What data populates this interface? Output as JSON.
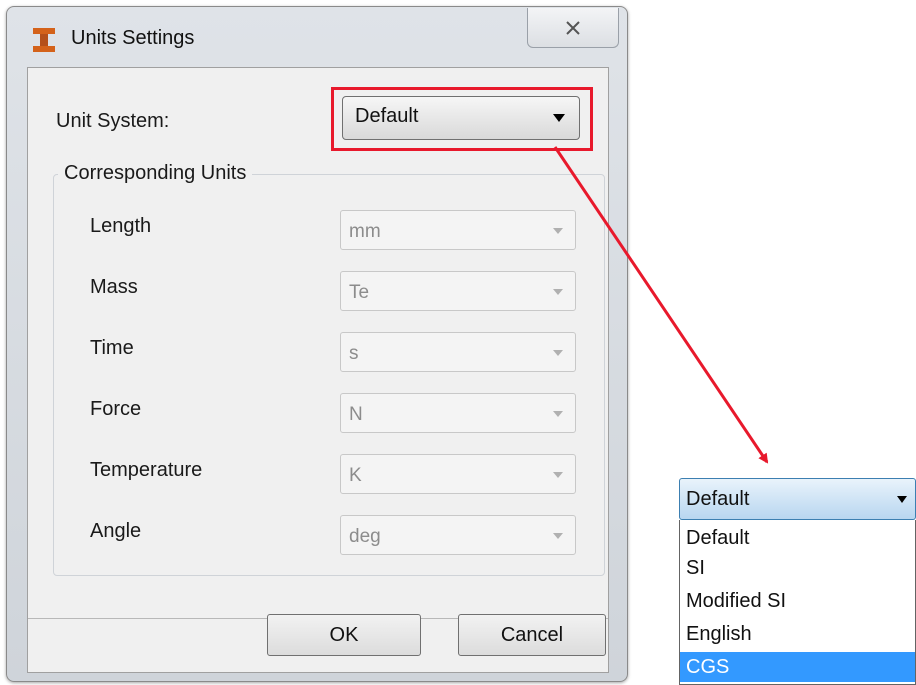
{
  "window": {
    "title": "Units Settings",
    "close_glyph": "✕"
  },
  "unit_system": {
    "label": "Unit System:",
    "value": "Default"
  },
  "group": {
    "title": "Corresponding Units",
    "rows": [
      {
        "label": "Length",
        "value": "mm"
      },
      {
        "label": "Mass",
        "value": "Te"
      },
      {
        "label": "Time",
        "value": "s"
      },
      {
        "label": "Force",
        "value": "N"
      },
      {
        "label": "Temperature",
        "value": "K"
      },
      {
        "label": "Angle",
        "value": "deg"
      }
    ]
  },
  "buttons": {
    "ok": "OK",
    "cancel": "Cancel"
  },
  "dropdown": {
    "value": "Default",
    "options": [
      "Default",
      "SI",
      "Modified SI",
      "English",
      "CGS"
    ],
    "highlighted": "CGS"
  },
  "colors": {
    "annotation_red": "#e8192c",
    "selection_blue": "#3399ff",
    "app_icon_orange": "#d4621a"
  },
  "icons": {
    "app": "i-beam-icon",
    "close": "close-icon",
    "combo_arrow": "chevron-down-icon"
  }
}
